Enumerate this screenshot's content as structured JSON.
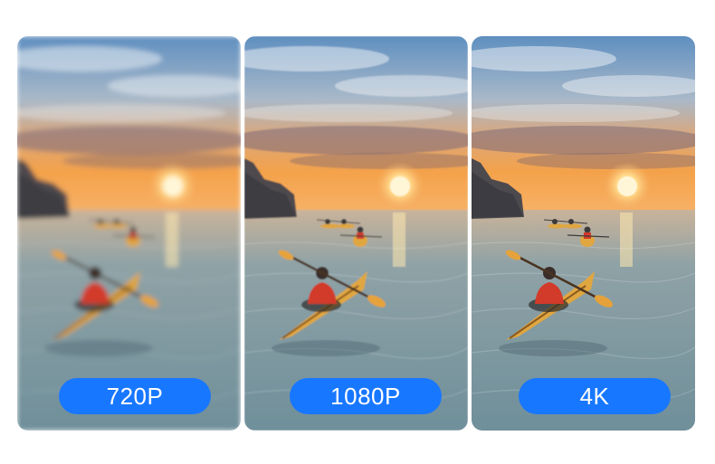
{
  "panels": [
    {
      "id": "720p",
      "label": "720P",
      "blur": 2.6
    },
    {
      "id": "1080p",
      "label": "1080P",
      "blur": 0.9
    },
    {
      "id": "4k",
      "label": "4K",
      "blur": 0
    }
  ],
  "colors": {
    "badge": "#1877ff",
    "sky_top": "#5f8fc0",
    "sunset": "#f4a24a",
    "sea": "#6f8f9a",
    "kayak": "#e0a640",
    "vest": "#d23a2a"
  }
}
